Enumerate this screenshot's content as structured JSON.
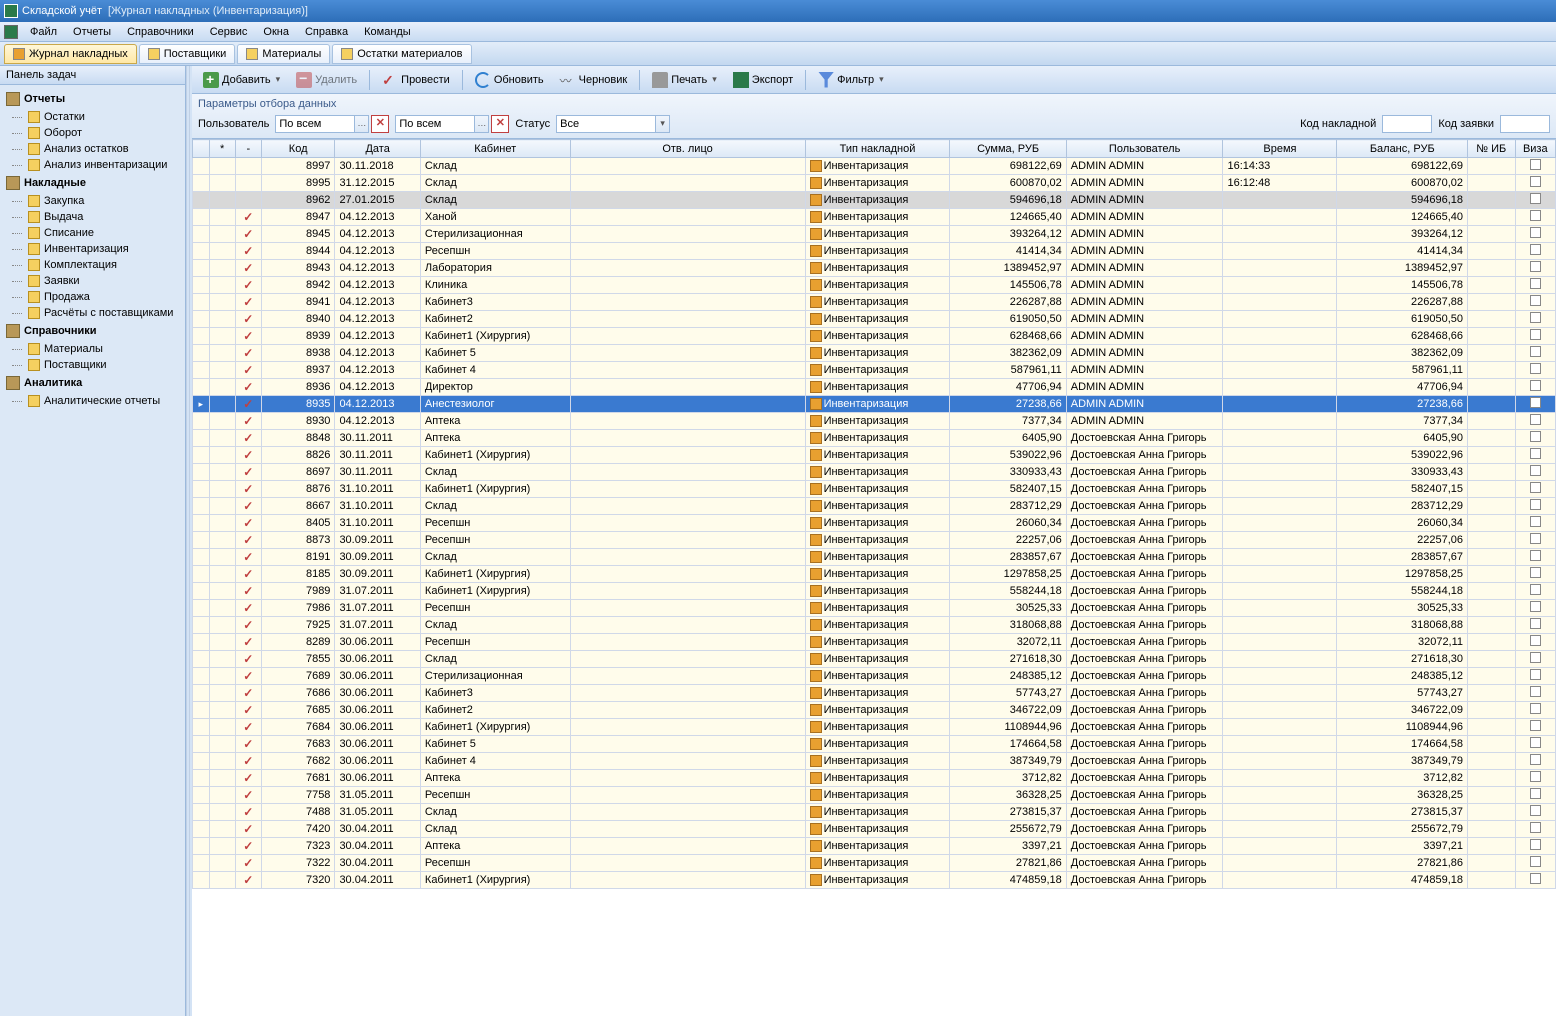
{
  "titlebar": {
    "app": "Складской учёт",
    "doc": "[Журнал накладных  (Инвентаризация)]"
  },
  "menu": [
    "Файл",
    "Отчеты",
    "Справочники",
    "Сервис",
    "Окна",
    "Справка",
    "Команды"
  ],
  "tabs": [
    {
      "label": "Журнал накладных",
      "active": true
    },
    {
      "label": "Поставщики",
      "active": false
    },
    {
      "label": "Материалы",
      "active": false
    },
    {
      "label": "Остатки материалов",
      "active": false
    }
  ],
  "sidebar": {
    "title": "Панель задач",
    "groups": [
      {
        "title": "Отчеты",
        "items": [
          "Остатки",
          "Оборот",
          "Анализ остатков",
          "Анализ инвентаризации"
        ]
      },
      {
        "title": "Накладные",
        "items": [
          "Закупка",
          "Выдача",
          "Списание",
          "Инвентаризация",
          "Комплектация",
          "Заявки",
          "Продажа",
          "Расчёты с поставщиками"
        ]
      },
      {
        "title": "Справочники",
        "items": [
          "Материалы",
          "Поставщики"
        ]
      },
      {
        "title": "Аналитика",
        "items": [
          "Аналитические отчеты"
        ]
      }
    ]
  },
  "toolbar": {
    "add": "Добавить",
    "del": "Удалить",
    "post": "Провести",
    "refresh": "Обновить",
    "draft": "Черновик",
    "print": "Печать",
    "export": "Экспорт",
    "filter": "Фильтр"
  },
  "filter": {
    "panel_title": "Параметры отбора данных",
    "user_label": "Пользователь",
    "user_value": "По всем",
    "combo2_value": "По всем",
    "status_label": "Статус",
    "status_value": "Все",
    "kod_label": "Код накладной",
    "zayavka_label": "Код заявки"
  },
  "columns": [
    "*",
    "-",
    "Код",
    "Дата",
    "Кабинет",
    "Отв. лицо",
    "Тип накладной",
    "Сумма, РУБ",
    "Пользователь",
    "Время",
    "Баланс, РУБ",
    "№ ИБ",
    "Виза"
  ],
  "doc_type": "Инвентаризация",
  "rows": [
    {
      "s": "",
      "c": false,
      "kod": "8997",
      "d": "30.11.2018",
      "kab": "Склад",
      "sum": "698122,69",
      "u": "ADMIN ADMIN",
      "t": "16:14:33",
      "bal": "698122,69"
    },
    {
      "s": "",
      "c": false,
      "kod": "8995",
      "d": "31.12.2015",
      "kab": "Склад",
      "sum": "600870,02",
      "u": "ADMIN ADMIN",
      "t": "16:12:48",
      "bal": "600870,02"
    },
    {
      "s": "gray",
      "c": false,
      "kod": "8962",
      "d": "27.01.2015",
      "kab": "Склад",
      "sum": "594696,18",
      "u": "ADMIN ADMIN",
      "t": "",
      "bal": "594696,18"
    },
    {
      "s": "",
      "c": true,
      "kod": "8947",
      "d": "04.12.2013",
      "kab": "Ханой",
      "sum": "124665,40",
      "u": "ADMIN ADMIN",
      "t": "",
      "bal": "124665,40"
    },
    {
      "s": "",
      "c": true,
      "kod": "8945",
      "d": "04.12.2013",
      "kab": "Стерилизационная",
      "sum": "393264,12",
      "u": "ADMIN ADMIN",
      "t": "",
      "bal": "393264,12"
    },
    {
      "s": "",
      "c": true,
      "kod": "8944",
      "d": "04.12.2013",
      "kab": "Ресепшн",
      "sum": "41414,34",
      "u": "ADMIN ADMIN",
      "t": "",
      "bal": "41414,34"
    },
    {
      "s": "",
      "c": true,
      "kod": "8943",
      "d": "04.12.2013",
      "kab": "Лаборатория",
      "sum": "1389452,97",
      "u": "ADMIN ADMIN",
      "t": "",
      "bal": "1389452,97"
    },
    {
      "s": "",
      "c": true,
      "kod": "8942",
      "d": "04.12.2013",
      "kab": "Клиника",
      "sum": "145506,78",
      "u": "ADMIN ADMIN",
      "t": "",
      "bal": "145506,78"
    },
    {
      "s": "",
      "c": true,
      "kod": "8941",
      "d": "04.12.2013",
      "kab": "Кабинет3",
      "sum": "226287,88",
      "u": "ADMIN ADMIN",
      "t": "",
      "bal": "226287,88"
    },
    {
      "s": "",
      "c": true,
      "kod": "8940",
      "d": "04.12.2013",
      "kab": "Кабинет2",
      "sum": "619050,50",
      "u": "ADMIN ADMIN",
      "t": "",
      "bal": "619050,50"
    },
    {
      "s": "",
      "c": true,
      "kod": "8939",
      "d": "04.12.2013",
      "kab": "Кабинет1 (Хирургия)",
      "sum": "628468,66",
      "u": "ADMIN ADMIN",
      "t": "",
      "bal": "628468,66"
    },
    {
      "s": "",
      "c": true,
      "kod": "8938",
      "d": "04.12.2013",
      "kab": "Кабинет 5",
      "sum": "382362,09",
      "u": "ADMIN ADMIN",
      "t": "",
      "bal": "382362,09"
    },
    {
      "s": "",
      "c": true,
      "kod": "8937",
      "d": "04.12.2013",
      "kab": "Кабинет 4",
      "sum": "587961,11",
      "u": "ADMIN ADMIN",
      "t": "",
      "bal": "587961,11"
    },
    {
      "s": "",
      "c": true,
      "kod": "8936",
      "d": "04.12.2013",
      "kab": "Директор",
      "sum": "47706,94",
      "u": "ADMIN ADMIN",
      "t": "",
      "bal": "47706,94"
    },
    {
      "s": "sel",
      "c": true,
      "kod": "8935",
      "d": "04.12.2013",
      "kab": "Анестезиолог",
      "sum": "27238,66",
      "u": "ADMIN ADMIN",
      "t": "",
      "bal": "27238,66",
      "ind": "▸"
    },
    {
      "s": "",
      "c": true,
      "kod": "8930",
      "d": "04.12.2013",
      "kab": "Аптека",
      "sum": "7377,34",
      "u": "ADMIN ADMIN",
      "t": "",
      "bal": "7377,34"
    },
    {
      "s": "",
      "c": true,
      "kod": "8848",
      "d": "30.11.2011",
      "kab": "Аптека",
      "sum": "6405,90",
      "u": "Достоевская Анна Григорь",
      "t": "",
      "bal": "6405,90"
    },
    {
      "s": "",
      "c": true,
      "kod": "8826",
      "d": "30.11.2011",
      "kab": "Кабинет1 (Хирургия)",
      "sum": "539022,96",
      "u": "Достоевская Анна Григорь",
      "t": "",
      "bal": "539022,96"
    },
    {
      "s": "",
      "c": true,
      "kod": "8697",
      "d": "30.11.2011",
      "kab": "Склад",
      "sum": "330933,43",
      "u": "Достоевская Анна Григорь",
      "t": "",
      "bal": "330933,43"
    },
    {
      "s": "",
      "c": true,
      "kod": "8876",
      "d": "31.10.2011",
      "kab": "Кабинет1 (Хирургия)",
      "sum": "582407,15",
      "u": "Достоевская Анна Григорь",
      "t": "",
      "bal": "582407,15"
    },
    {
      "s": "",
      "c": true,
      "kod": "8667",
      "d": "31.10.2011",
      "kab": "Склад",
      "sum": "283712,29",
      "u": "Достоевская Анна Григорь",
      "t": "",
      "bal": "283712,29"
    },
    {
      "s": "",
      "c": true,
      "kod": "8405",
      "d": "31.10.2011",
      "kab": "Ресепшн",
      "sum": "26060,34",
      "u": "Достоевская Анна Григорь",
      "t": "",
      "bal": "26060,34"
    },
    {
      "s": "",
      "c": true,
      "kod": "8873",
      "d": "30.09.2011",
      "kab": "Ресепшн",
      "sum": "22257,06",
      "u": "Достоевская Анна Григорь",
      "t": "",
      "bal": "22257,06"
    },
    {
      "s": "",
      "c": true,
      "kod": "8191",
      "d": "30.09.2011",
      "kab": "Склад",
      "sum": "283857,67",
      "u": "Достоевская Анна Григорь",
      "t": "",
      "bal": "283857,67"
    },
    {
      "s": "",
      "c": true,
      "kod": "8185",
      "d": "30.09.2011",
      "kab": "Кабинет1 (Хирургия)",
      "sum": "1297858,25",
      "u": "Достоевская Анна Григорь",
      "t": "",
      "bal": "1297858,25"
    },
    {
      "s": "",
      "c": true,
      "kod": "7989",
      "d": "31.07.2011",
      "kab": "Кабинет1 (Хирургия)",
      "sum": "558244,18",
      "u": "Достоевская Анна Григорь",
      "t": "",
      "bal": "558244,18"
    },
    {
      "s": "",
      "c": true,
      "kod": "7986",
      "d": "31.07.2011",
      "kab": "Ресепшн",
      "sum": "30525,33",
      "u": "Достоевская Анна Григорь",
      "t": "",
      "bal": "30525,33"
    },
    {
      "s": "",
      "c": true,
      "kod": "7925",
      "d": "31.07.2011",
      "kab": "Склад",
      "sum": "318068,88",
      "u": "Достоевская Анна Григорь",
      "t": "",
      "bal": "318068,88"
    },
    {
      "s": "",
      "c": true,
      "kod": "8289",
      "d": "30.06.2011",
      "kab": "Ресепшн",
      "sum": "32072,11",
      "u": "Достоевская Анна Григорь",
      "t": "",
      "bal": "32072,11"
    },
    {
      "s": "",
      "c": true,
      "kod": "7855",
      "d": "30.06.2011",
      "kab": "Склад",
      "sum": "271618,30",
      "u": "Достоевская Анна Григорь",
      "t": "",
      "bal": "271618,30"
    },
    {
      "s": "",
      "c": true,
      "kod": "7689",
      "d": "30.06.2011",
      "kab": "Стерилизационная",
      "sum": "248385,12",
      "u": "Достоевская Анна Григорь",
      "t": "",
      "bal": "248385,12"
    },
    {
      "s": "",
      "c": true,
      "kod": "7686",
      "d": "30.06.2011",
      "kab": "Кабинет3",
      "sum": "57743,27",
      "u": "Достоевская Анна Григорь",
      "t": "",
      "bal": "57743,27"
    },
    {
      "s": "",
      "c": true,
      "kod": "7685",
      "d": "30.06.2011",
      "kab": "Кабинет2",
      "sum": "346722,09",
      "u": "Достоевская Анна Григорь",
      "t": "",
      "bal": "346722,09"
    },
    {
      "s": "",
      "c": true,
      "kod": "7684",
      "d": "30.06.2011",
      "kab": "Кабинет1 (Хирургия)",
      "sum": "1108944,96",
      "u": "Достоевская Анна Григорь",
      "t": "",
      "bal": "1108944,96"
    },
    {
      "s": "",
      "c": true,
      "kod": "7683",
      "d": "30.06.2011",
      "kab": "Кабинет 5",
      "sum": "174664,58",
      "u": "Достоевская Анна Григорь",
      "t": "",
      "bal": "174664,58"
    },
    {
      "s": "",
      "c": true,
      "kod": "7682",
      "d": "30.06.2011",
      "kab": "Кабинет 4",
      "sum": "387349,79",
      "u": "Достоевская Анна Григорь",
      "t": "",
      "bal": "387349,79"
    },
    {
      "s": "",
      "c": true,
      "kod": "7681",
      "d": "30.06.2011",
      "kab": "Аптека",
      "sum": "3712,82",
      "u": "Достоевская Анна Григорь",
      "t": "",
      "bal": "3712,82"
    },
    {
      "s": "",
      "c": true,
      "kod": "7758",
      "d": "31.05.2011",
      "kab": "Ресепшн",
      "sum": "36328,25",
      "u": "Достоевская Анна Григорь",
      "t": "",
      "bal": "36328,25"
    },
    {
      "s": "",
      "c": true,
      "kod": "7488",
      "d": "31.05.2011",
      "kab": "Склад",
      "sum": "273815,37",
      "u": "Достоевская Анна Григорь",
      "t": "",
      "bal": "273815,37"
    },
    {
      "s": "",
      "c": true,
      "kod": "7420",
      "d": "30.04.2011",
      "kab": "Склад",
      "sum": "255672,79",
      "u": "Достоевская Анна Григорь",
      "t": "",
      "bal": "255672,79"
    },
    {
      "s": "",
      "c": true,
      "kod": "7323",
      "d": "30.04.2011",
      "kab": "Аптека",
      "sum": "3397,21",
      "u": "Достоевская Анна Григорь",
      "t": "",
      "bal": "3397,21"
    },
    {
      "s": "",
      "c": true,
      "kod": "7322",
      "d": "30.04.2011",
      "kab": "Ресепшн",
      "sum": "27821,86",
      "u": "Достоевская Анна Григорь",
      "t": "",
      "bal": "27821,86"
    },
    {
      "s": "",
      "c": true,
      "kod": "7320",
      "d": "30.04.2011",
      "kab": "Кабинет1 (Хирургия)",
      "sum": "474859,18",
      "u": "Достоевская Анна Григорь",
      "t": "",
      "bal": "474859,18"
    }
  ]
}
